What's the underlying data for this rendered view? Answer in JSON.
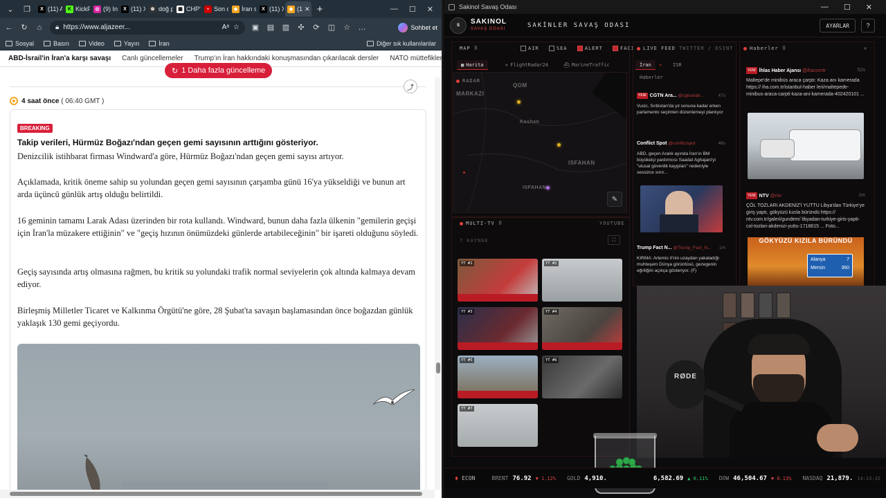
{
  "browser": {
    "tabs": [
      "(11) Ar",
      "KickPe",
      "(9) Ins",
      "(11) X",
      "doğ pı",
      "CHP'n",
      "Son d",
      "İran sa",
      "(11) X",
      "(1"
    ],
    "url": "https://www.aljazeer...",
    "copilot_label": "Sohbet et",
    "bookmarks": [
      "Sosyal",
      "Basın",
      "Video",
      "Yayın",
      "İran"
    ],
    "bookmarks_other": "Diğer sık kullanılanlar",
    "nav_links": [
      "ABD-İsrail'in İran'a karşı savaşı",
      "Canlı güncellemeler",
      "Trump'ın İran hakkındaki konuşmasından çıkarılacak dersler",
      "NATO müttefikleri Trump"
    ],
    "update_pill": "1 Daha fazla güncelleme"
  },
  "article": {
    "time_ago": "4 saat önce",
    "time_gmt": "( 06:40 GMT )",
    "badge": "BREAKING",
    "headline": "Takip verileri, Hürmüz Boğazı'ndan geçen gemi sayısının arttığını gösteriyor.",
    "paragraphs": [
      "Denizcilik istihbarat firması Windward'a göre, Hürmüz Boğazı'ndan geçen gemi sayısı artıyor.",
      "Açıklamada, kritik öneme sahip su yolundan geçen gemi sayısının çarşamba günü 16'ya yükseldiği ve bunun art arda üçüncü günlük artış olduğu belirtildi.",
      "16 geminin tamamı Larak Adası üzerinden bir rota kullandı. Windward, bunun daha fazla ülkenin \"gemilerin geçişi için İran'la müzakere ettiğinin\" ve \"geçiş hızının önümüzdeki günlerde artabileceğinin\" bir işareti olduğunu söyledi.",
      "Geçiş sayısında artış olmasına rağmen, bu kritik su yolundaki trafik normal seviyelerin çok altında kalmaya devam ediyor.",
      "Birleşmiş Milletler Ticaret ve Kalkınma Örgütü'ne göre, 28 Şubat'ta savaşın başlamasından önce boğazdan günlük yaklaşık 130 gemi geçiyordu."
    ]
  },
  "dash": {
    "window_title": "Sakinol Savaş Odası",
    "brand_name": "SAKINOL",
    "brand_sub": "SAVAŞ ODASI",
    "room_title": "SAKİNLER SAVAŞ ODASI",
    "settings": "AYARLAR",
    "help": "?",
    "map_label": "MAP",
    "filters": [
      "AIR",
      "SEA",
      "ALERT",
      "FACILITY"
    ],
    "map_tabs": [
      "Harita",
      "FlightRadar24",
      "MarineTraffic"
    ],
    "radar": "RADAR",
    "cities": [
      "MARKAZI",
      "QOM",
      "Kashan",
      "ISFAHAN",
      "ISFAHAN"
    ],
    "multitv": "MULTI-TV",
    "youtube": "YOUTUBE",
    "source_count": "7 KAYNAK",
    "videos": [
      "YT #1",
      "YT #2",
      "YT #3",
      "YT #4",
      "YT #5",
      "YT #6",
      "YT #7"
    ],
    "livefeed": "LIVE FEED",
    "livefeed_src": "TWITTER / OSINT",
    "feed_tabs": [
      "İran",
      "ISR",
      "Haberler"
    ],
    "feed": [
      {
        "src": "CGTN Ara...",
        "handle": "@cgtnarab...",
        "time": "47s",
        "text": "Vucic, Sırbistan'da yıl sonuna kadar erken parlamento seçimleri düzenlemeyi planlıyor"
      },
      {
        "src": "Conflict Spot",
        "handle": "@conflictspot",
        "time": "48s",
        "text": "ABD, geçen Aralık ayında İran'ın BM büyükelçi yardımcısı Saadat Aghajani'yi \"ulusal güvenlik kaygıları\" nedeniyle sessizce sınır..."
      },
      {
        "src": "Trump Fact N...",
        "handle": "@Trump_Fact_N...",
        "time": "1m",
        "text": "KIRMA: Artemis II'nin uzaydan yakaladığı muhteşem Dünya görüntüsü, gezegenin eğriliğini açıkça gösteriyor. (F)"
      }
    ],
    "news_label": "Haberler",
    "news": [
      {
        "src": "İhlas Haber Ajansı",
        "handle": "@ihacomtr",
        "time": "52s",
        "text": "Maltepe'de minibüs araca çarptı: Kaza anı kamerada https:// iha.com.tr/istanbul-haber leri/maltepede-minibus-araca-carpti-kaza-ani-kamerada-402420101 ..."
      },
      {
        "src": "NTV",
        "handle": "@ntv",
        "time": "1m",
        "text": "ÇÖL TOZLARI AKDENİZ'İ YUTTU Libya'dan Türkiye'ye giriş yaptı, gökyüzü kızıla büründü https:// ntv.com.tr/galeri/gundem/ libyadan-turkiye-giris-yapti-col-tozlari-akdenizi-yuttu-1718615 ... Foto..."
      }
    ],
    "news_img_caption": "GÖKYÜZÜ KIZILA BÜRÜNDÜ",
    "sign": [
      "Alanya",
      "7",
      "Mersin",
      "360"
    ],
    "new_badge": "YENİ",
    "econ": {
      "label": "ECON",
      "items": [
        {
          "k": "BRENT",
          "v": "76.92",
          "c": "▼ 1.12%",
          "dir": "dn"
        },
        {
          "k": "GOLD",
          "v": "4,910.",
          "c": "",
          "dir": ""
        },
        {
          "k": "",
          "v": "6,582.69",
          "c": "▲ 0.11%",
          "dir": "up"
        },
        {
          "k": "DOW",
          "v": "46,504.67",
          "c": "▼ 0.13%",
          "dir": "dn"
        },
        {
          "k": "NASDAQ",
          "v": "21,879.",
          "c": "",
          "dir": ""
        }
      ],
      "time": "14:13:32"
    },
    "cam_shirt_text": "RØDE"
  }
}
